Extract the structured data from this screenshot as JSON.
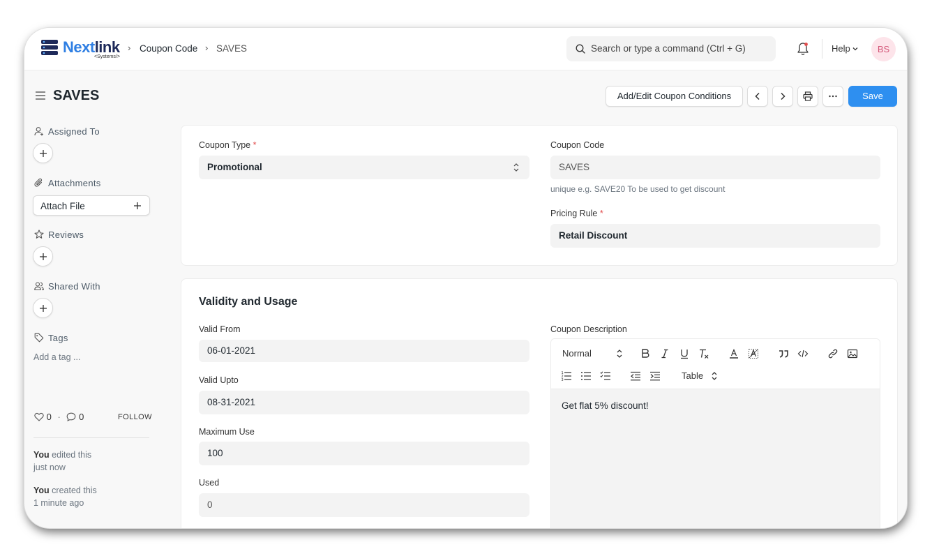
{
  "navbar": {
    "logo_word_a": "Next",
    "logo_word_b": "link",
    "logo_sub": "<Systems/>",
    "breadcrumbs": [
      "Coupon Code",
      "SAVES"
    ],
    "search_placeholder": "Search or type a command (Ctrl + G)",
    "help_label": "Help",
    "avatar_initials": "BS"
  },
  "header": {
    "title": "SAVES",
    "conditions_button": "Add/Edit Coupon Conditions",
    "save_button": "Save"
  },
  "sidebar": {
    "assigned_to": "Assigned To",
    "attachments": "Attachments",
    "attach_file": "Attach File",
    "reviews": "Reviews",
    "shared_with": "Shared With",
    "tags": "Tags",
    "tag_placeholder": "Add a tag ...",
    "likes": "0",
    "comments": "0",
    "separator": "·",
    "follow": "FOLLOW",
    "activity": [
      {
        "who": "You",
        "action": "edited this",
        "when": "just now"
      },
      {
        "who": "You",
        "action": "created this",
        "when": "1 minute ago"
      }
    ]
  },
  "details": {
    "coupon_type_label": "Coupon Type",
    "coupon_type_value": "Promotional",
    "coupon_code_label": "Coupon Code",
    "coupon_code_value": "SAVES",
    "coupon_code_help": "unique e.g. SAVE20 To be used to get discount",
    "pricing_rule_label": "Pricing Rule",
    "pricing_rule_value": "Retail Discount",
    "required_mark": "*"
  },
  "validity": {
    "section_title": "Validity and Usage",
    "valid_from_label": "Valid From",
    "valid_from_value": "06-01-2021",
    "valid_upto_label": "Valid Upto",
    "valid_upto_value": "08-31-2021",
    "max_use_label": "Maximum Use",
    "max_use_value": "100",
    "used_label": "Used",
    "used_value": "0",
    "description_label": "Coupon Description",
    "editor_format": "Normal",
    "editor_table": "Table",
    "description_text": "Get flat 5% discount!"
  },
  "colors": {
    "primary": "#2e8ff0",
    "logo_blue": "#2f7fe3",
    "required": "#e24c4c"
  }
}
